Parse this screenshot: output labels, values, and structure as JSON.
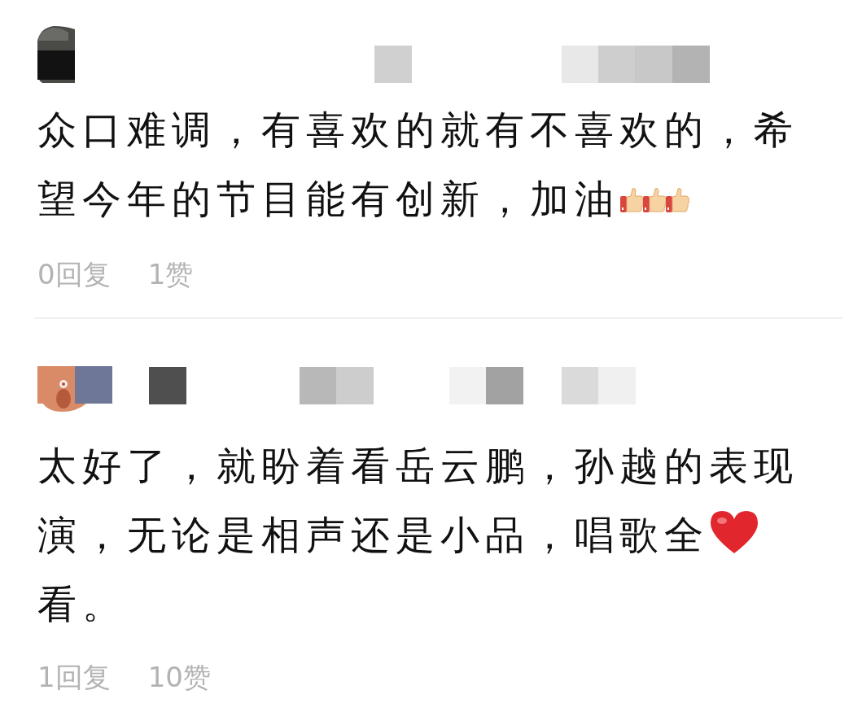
{
  "comments": [
    {
      "body": [
        {
          "kind": "text",
          "text": "众口难调，有喜欢的就有不喜欢的，希望今年的节目能有创新，加油"
        },
        {
          "kind": "thumbs_up"
        },
        {
          "kind": "thumbs_up"
        },
        {
          "kind": "thumbs_up"
        }
      ],
      "replies": "0回复",
      "likes": "1赞"
    },
    {
      "body": [
        {
          "kind": "text",
          "text": "太好了，就盼着看岳云鹏，孙越的表现演，无论是相声还是小品，唱歌全"
        },
        {
          "kind": "heart"
        },
        {
          "kind": "text",
          "text": "看。"
        }
      ],
      "replies": "1回复",
      "likes": "10赞"
    }
  ]
}
